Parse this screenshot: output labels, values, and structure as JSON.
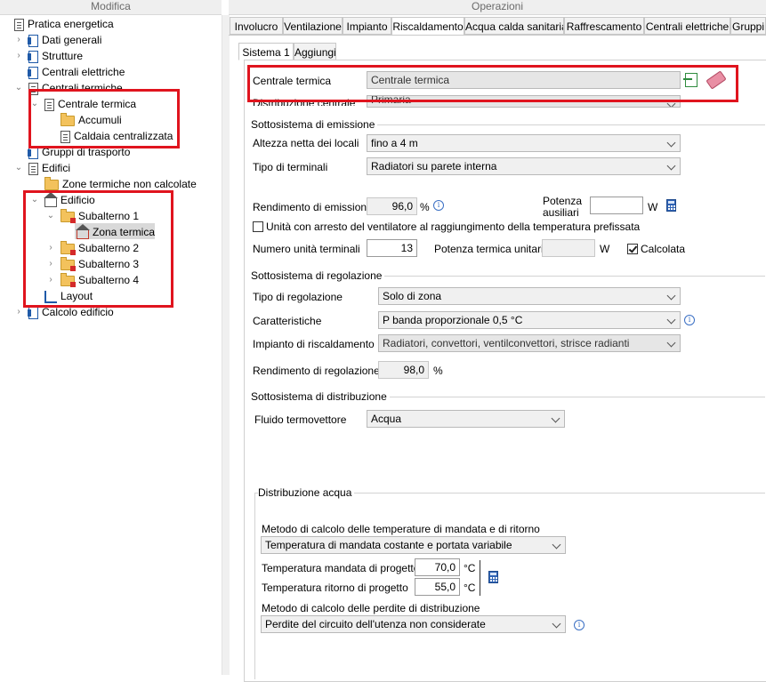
{
  "headers": {
    "left": "Modifica",
    "right": "Operazioni"
  },
  "tree": {
    "items": [
      {
        "label": "Pratica energetica"
      },
      {
        "label": "Dati generali"
      },
      {
        "label": "Strutture"
      },
      {
        "label": "Centrali elettriche"
      },
      {
        "label": "Centrali termiche"
      },
      {
        "label": "Centrale termica"
      },
      {
        "label": "Accumuli"
      },
      {
        "label": "Caldaia centralizzata"
      },
      {
        "label": "Gruppi di trasporto"
      },
      {
        "label": "Edifici"
      },
      {
        "label": "Zone termiche non calcolate"
      },
      {
        "label": "Edificio"
      },
      {
        "label": "Subalterno 1"
      },
      {
        "label": "Zona termica"
      },
      {
        "label": "Subalterno 2"
      },
      {
        "label": "Subalterno 3"
      },
      {
        "label": "Subalterno 4"
      },
      {
        "label": "Layout"
      },
      {
        "label": "Calcolo edificio"
      }
    ]
  },
  "tabs": [
    {
      "label": "Involucro"
    },
    {
      "label": "Ventilazione"
    },
    {
      "label": "Impianto"
    },
    {
      "label": "Riscaldamento"
    },
    {
      "label": "Acqua calda sanitaria"
    },
    {
      "label": "Raffrescamento"
    },
    {
      "label": "Centrali elettriche"
    },
    {
      "label": "Gruppi"
    }
  ],
  "subtabs": [
    {
      "label": "Sistema 1"
    },
    {
      "label": "Aggiungi"
    }
  ],
  "central": {
    "label": "Centrale termica",
    "value": "Centrale termica",
    "distribution_label": "Distribuzione centrale",
    "distribution_value": "Primaria"
  },
  "emission": {
    "title": "Sottosistema di emissione",
    "height_label": "Altezza netta dei locali",
    "height_value": "fino a 4 m",
    "terminals_label": "Tipo di terminali",
    "terminals_value": "Radiatori su parete interna",
    "efficiency_label": "Rendimento di emissione",
    "efficiency_value": "96,0",
    "efficiency_unit": "%",
    "aux_power_label_1": "Potenza",
    "aux_power_label_2": "ausiliari",
    "aux_power_value": "",
    "aux_power_unit": "W",
    "fan_stop_label": "Unità con arresto del ventilatore al raggiungimento della temperatura prefissata",
    "units_label": "Numero unità terminali",
    "units_value": "13",
    "unit_power_label": "Potenza termica unitaria",
    "unit_power_value": "",
    "unit_power_unit": "W",
    "calculated_label": "Calcolata"
  },
  "regulation": {
    "title": "Sottosistema di regolazione",
    "type_label": "Tipo di regolazione",
    "type_value": "Solo di zona",
    "features_label": "Caratteristiche",
    "features_value": "P banda proporzionale 0,5 °C",
    "plant_label": "Impianto di riscaldamento",
    "plant_value": "Radiatori, convettori, ventilconvettori, strisce radianti",
    "efficiency_label": "Rendimento di regolazione",
    "efficiency_value": "98,0",
    "efficiency_unit": "%"
  },
  "distribution": {
    "title": "Sottosistema di distribuzione",
    "fluid_label": "Fluido termovettore",
    "fluid_value": "Acqua",
    "water_title": "Distribuzione acqua",
    "temp_method_label": "Metodo di calcolo delle temperature di mandata e di ritorno",
    "temp_method_value": "Temperatura di mandata costante e portata variabile",
    "supply_label": "Temperatura mandata di progetto",
    "supply_value": "70,0",
    "supply_unit": "°C",
    "return_label": "Temperatura ritorno di progetto",
    "return_value": "55,0",
    "return_unit": "°C",
    "loss_method_label": "Metodo di calcolo delle perdite di distribuzione",
    "loss_method_value": "Perdite del circuito dell'utenza non considerate"
  }
}
